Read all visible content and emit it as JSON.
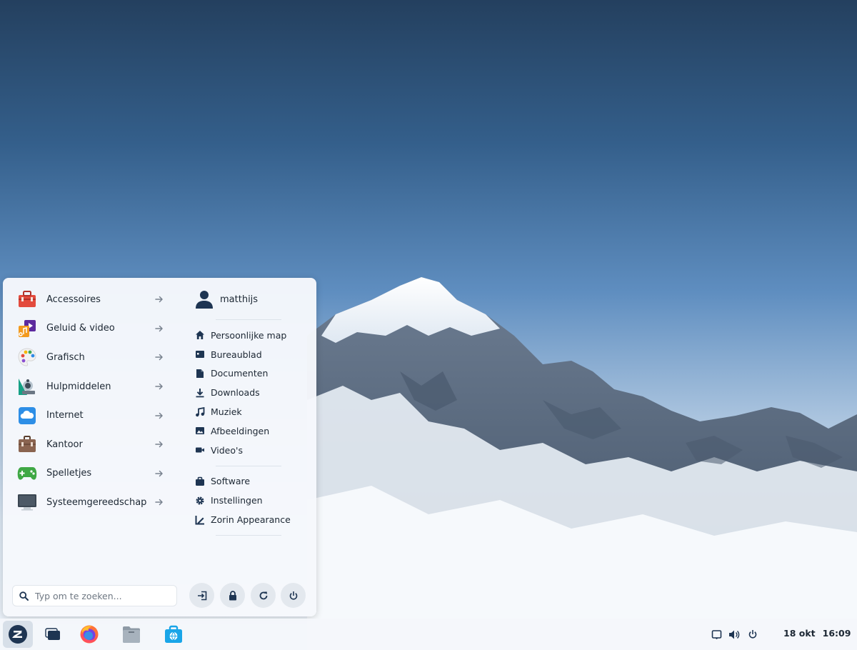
{
  "menu": {
    "categories": [
      {
        "label": "Accessoires",
        "icon": "toolbox-icon"
      },
      {
        "label": "Geluid & video",
        "icon": "multimedia-icon"
      },
      {
        "label": "Grafisch",
        "icon": "palette-icon"
      },
      {
        "label": "Hulpmiddelen",
        "icon": "accessibility-icon"
      },
      {
        "label": "Internet",
        "icon": "cloud-icon"
      },
      {
        "label": "Kantoor",
        "icon": "briefcase-icon"
      },
      {
        "label": "Spelletjes",
        "icon": "gamepad-icon"
      },
      {
        "label": "Systeemgereedschap",
        "icon": "monitor-icon"
      }
    ],
    "user": {
      "name": "matthijs"
    },
    "places": [
      {
        "label": "Persoonlijke map",
        "icon": "home-icon"
      },
      {
        "label": "Bureaublad",
        "icon": "desktop-icon"
      },
      {
        "label": "Documenten",
        "icon": "document-icon"
      },
      {
        "label": "Downloads",
        "icon": "download-icon"
      },
      {
        "label": "Muziek",
        "icon": "music-icon"
      },
      {
        "label": "Afbeeldingen",
        "icon": "image-icon"
      },
      {
        "label": "Video's",
        "icon": "video-icon"
      }
    ],
    "system": [
      {
        "label": "Software",
        "icon": "software-bag-icon"
      },
      {
        "label": "Instellingen",
        "icon": "settings-gear-icon"
      },
      {
        "label": "Zorin Appearance",
        "icon": "appearance-icon"
      }
    ],
    "search": {
      "placeholder": "Typ om te zoeken..."
    },
    "actions": [
      {
        "icon": "logout-icon"
      },
      {
        "icon": "lock-icon"
      },
      {
        "icon": "restart-icon"
      },
      {
        "icon": "power-icon"
      }
    ]
  },
  "taskbar": {
    "apps": [
      "zorin-menu-icon",
      "workspaces-icon",
      "firefox-icon",
      "files-icon",
      "software-store-icon"
    ],
    "tray": [
      "notifications-icon",
      "volume-icon",
      "power-icon"
    ],
    "date": "18 okt",
    "time": "16:09"
  },
  "colors": {
    "text": "#1c2733",
    "menu_bg": "#f6f8fc",
    "icon_dark": "#1e3552",
    "button_bg": "#e3e8ee"
  }
}
